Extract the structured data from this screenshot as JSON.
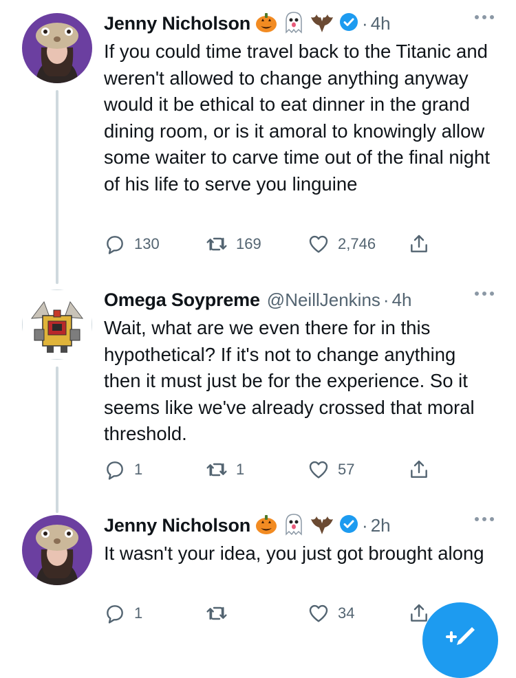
{
  "tweets": [
    {
      "name": "Jenny Nicholson",
      "handle": "",
      "time": "4h",
      "text": "If you could time travel back to the Titanic and weren't allowed to change anything anyway would it be ethical to eat dinner in the grand dining room, or is it amoral to knowingly allow some waiter to carve time out of the final night of his life to serve you linguine",
      "replies": "130",
      "retweets": "169",
      "likes": "2,746",
      "verified": true,
      "emojis": [
        "pumpkin-icon",
        "ghost-icon",
        "bat-icon"
      ]
    },
    {
      "name": "Omega Soypreme",
      "handle": "@NeillJenkins",
      "time": "4h",
      "text": "Wait, what are we even there for in this hypothetical? If it's not to change anything then it must just be for the experience. So it seems like we've already crossed that moral threshold.",
      "replies": "1",
      "retweets": "1",
      "likes": "57",
      "verified": false
    },
    {
      "name": "Jenny Nicholson",
      "handle": "",
      "time": "2h",
      "text": "It wasn't your idea, you just got brought along",
      "replies": "1",
      "retweets": "",
      "likes": "34",
      "verified": true,
      "emojis": [
        "pumpkin-icon",
        "ghost-icon",
        "bat-icon"
      ]
    }
  ],
  "separator": "·",
  "colors": {
    "accent": "#1d9bf0",
    "secondary_text": "#536471",
    "thread_line": "#cfd9de"
  }
}
